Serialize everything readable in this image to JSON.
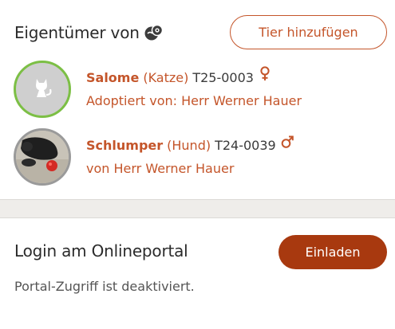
{
  "owners": {
    "title": "Eigentümer von",
    "title_icon": "animal-owner-icon",
    "add_button_label": "Tier hinzufügen",
    "animals": [
      {
        "name": "Salome",
        "species": "(Katze)",
        "id": "T25-0003",
        "sex_icon": "female-icon",
        "detail": "Adoptiert von: Herr Werner Hauer",
        "avatar": "cat-placeholder-icon",
        "avatar_border_color": "#7cbf45"
      },
      {
        "name": "Schlumper",
        "species": "(Hund)",
        "id": "T24-0039",
        "sex_icon": "male-icon",
        "detail": "von Herr Werner Hauer",
        "avatar": "dog-photo",
        "avatar_border_color": "#9a9a9a"
      }
    ]
  },
  "portal": {
    "title": "Login am Onlineportal",
    "invite_button_label": "Einladen",
    "status_text": "Portal-Zugriff ist deaktiviert."
  },
  "colors": {
    "accent": "#c4552a",
    "button_fill": "#a8390f",
    "background": "#efedea"
  }
}
